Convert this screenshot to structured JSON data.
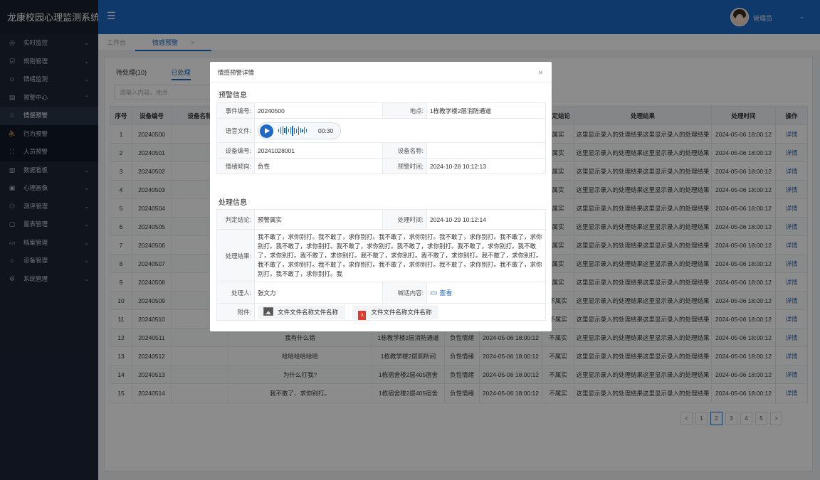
{
  "app": {
    "title": "龙康校园心理监测系统"
  },
  "sidebar": {
    "items": [
      {
        "label": "实时监控",
        "icon": "monitor-icon",
        "glyph": "◎",
        "arrow": "⌄"
      },
      {
        "label": "规则管理",
        "icon": "rules-icon",
        "glyph": "☑",
        "arrow": "⌄"
      },
      {
        "label": "情绪监测",
        "icon": "emotion-icon",
        "glyph": "☺",
        "arrow": "⌄"
      },
      {
        "label": "预警中心",
        "icon": "alert-center-icon",
        "glyph": "▤",
        "arrow": "⌃"
      },
      {
        "label": "情感预警",
        "icon": "bell-icon",
        "glyph": "♧",
        "arrow": ""
      },
      {
        "label": "行为预警",
        "icon": "run-icon",
        "glyph": "⛹",
        "arrow": ""
      },
      {
        "label": "人员预警",
        "icon": "person-scan-icon",
        "glyph": "⛶",
        "arrow": ""
      },
      {
        "label": "数据看板",
        "icon": "dashboard-icon",
        "glyph": "▥",
        "arrow": "⌄"
      },
      {
        "label": "心理画像",
        "icon": "portrait-icon",
        "glyph": "▣",
        "arrow": "⌄"
      },
      {
        "label": "测评管理",
        "icon": "assessment-icon",
        "glyph": "⚇",
        "arrow": "⌄"
      },
      {
        "label": "量表管理",
        "icon": "scale-icon",
        "glyph": "▢",
        "arrow": "⌄"
      },
      {
        "label": "档案管理",
        "icon": "archive-icon",
        "glyph": "▭",
        "arrow": "⌄"
      },
      {
        "label": "设备管理",
        "icon": "device-icon",
        "glyph": "⌂",
        "arrow": "⌄"
      },
      {
        "label": "系统管理",
        "icon": "settings-icon",
        "glyph": "⚙",
        "arrow": "⌄"
      }
    ]
  },
  "header": {
    "menu_glyph": "☰",
    "user_name": "管理员",
    "user_arrow": "⌄"
  },
  "tabs": {
    "workbench": "工作台",
    "current": "情感预警",
    "close": "×"
  },
  "subtabs": {
    "pending": "待处理(10)",
    "done": "已处理"
  },
  "search": {
    "placeholder": "请输入内容、地点"
  },
  "table": {
    "headers": [
      "序号",
      "设备编号",
      "设备名称",
      "",
      "",
      "",
      "",
      "判定结论",
      "处理结果",
      "处理时间",
      "操作"
    ],
    "rows": [
      [
        "1",
        "20240500",
        "",
        "",
        "",
        "",
        "",
        "属实",
        "这里显示录入的处理结果这里显示录入的处理结果",
        "2024-05-06 18:00:12",
        "详情"
      ],
      [
        "2",
        "20240501",
        "",
        "",
        "",
        "",
        "",
        "属实",
        "这里显示录入的处理结果这里显示录入的处理结果",
        "2024-05-06 18:00:12",
        "详情"
      ],
      [
        "3",
        "20240502",
        "",
        "",
        "",
        "",
        "",
        "属实",
        "这里显示录入的处理结果这里显示录入的处理结果",
        "2024-05-06 18:00:12",
        "详情"
      ],
      [
        "4",
        "20240503",
        "",
        "",
        "",
        "",
        "",
        "属实",
        "这里显示录入的处理结果这里显示录入的处理结果",
        "2024-05-06 18:00:12",
        "详情"
      ],
      [
        "5",
        "20240504",
        "",
        "",
        "",
        "",
        "",
        "属实",
        "这里显示录入的处理结果这里显示录入的处理结果",
        "2024-05-06 18:00:12",
        "详情"
      ],
      [
        "6",
        "20240505",
        "",
        "",
        "",
        "",
        "",
        "属实",
        "这里显示录入的处理结果这里显示录入的处理结果",
        "2024-05-06 18:00:12",
        "详情"
      ],
      [
        "7",
        "20240506",
        "",
        "",
        "",
        "",
        "",
        "属实",
        "这里显示录入的处理结果这里显示录入的处理结果",
        "2024-05-06 18:00:12",
        "详情"
      ],
      [
        "8",
        "20240507",
        "",
        "",
        "",
        "",
        "",
        "属实",
        "这里显示录入的处理结果这里显示录入的处理结果",
        "2024-05-06 18:00:12",
        "详情"
      ],
      [
        "9",
        "20240508",
        "",
        "",
        "",
        "",
        "",
        "属实",
        "这里显示录入的处理结果这里显示录入的处理结果",
        "2024-05-06 18:00:12",
        "详情"
      ],
      [
        "10",
        "20240509",
        "",
        "",
        "",
        "",
        "",
        "不属实",
        "这里显示录入的处理结果这里显示录入的处理结果",
        "2024-05-06 18:00:12",
        "详情"
      ],
      [
        "11",
        "20240510",
        "",
        "",
        "",
        "",
        "",
        "不属实",
        "这里显示录入的处理结果这里显示录入的处理结果",
        "2024-05-06 18:00:12",
        "详情"
      ],
      [
        "12",
        "20240511",
        "",
        "我有什么错",
        "1栋教学楼2层消防通道",
        "负性情绪",
        "2024-05-06 18:00:12",
        "不属实",
        "这里显示录入的处理结果这里显示录入的处理结果",
        "2024-05-06 18:00:12",
        "详情"
      ],
      [
        "13",
        "20240512",
        "",
        "哈哈哈哈哈哈",
        "1栋教学楼2层厕所间",
        "负性情绪",
        "2024-05-06 18:00:12",
        "不属实",
        "这里显示录入的处理结果这里显示录入的处理结果",
        "2024-05-06 18:00:12",
        "详情"
      ],
      [
        "14",
        "20240513",
        "",
        "为什么打我?",
        "1栋宿舍楼2层405宿舍",
        "负性情绪",
        "2024-05-06 18:00:12",
        "不属实",
        "这里显示录入的处理结果这里显示录入的处理结果",
        "2024-05-06 18:00:12",
        "详情"
      ],
      [
        "15",
        "20240514",
        "",
        "我不敢了、求你别打。",
        "1栋宿舍楼2层405宿舍",
        "负性情绪",
        "2024-05-06 18:00:12",
        "不属实",
        "这里显示录入的处理结果这里显示录入的处理结果",
        "2024-05-06 18:00:12",
        "详情"
      ]
    ]
  },
  "pagination": {
    "prev": "<",
    "pages": [
      "1",
      "2",
      "3",
      "4",
      "5"
    ],
    "current": "2",
    "next": ">"
  },
  "modal": {
    "title": "情感预警详情",
    "close": "×",
    "section_alert": "预警信息",
    "event_no_label": "事件编号:",
    "event_no": "20240500",
    "location_label": "地点:",
    "location": "1栋教学楼2层消防通道",
    "audio_label": "语音文件:",
    "audio_duration": "00:30",
    "device_no_label": "设备编号:",
    "device_no": "20241028001",
    "device_name_label": "设备名称:",
    "device_name": "",
    "emotion_label": "情绪倾向:",
    "emotion": "负性",
    "alert_time_label": "预警时间:",
    "alert_time": "2024-10-28 10:12:13",
    "section_handle": "处理信息",
    "verdict_label": "判定结论:",
    "verdict": "预警属实",
    "handle_time_label": "处理时间:",
    "handle_time": "2024-10-29 10:12:14",
    "result_label": "处理结果:",
    "result": "我不敢了，求你别打。我不敢了，求你别打。我不敢了，求你别打。我不敢了，求你别打。我不敢了，求你别打。我不敢了，求你别打。我不敢了，求你别打。我不敢了，求你别打。我不敢了，求你别打。我不敢了，求你别打。我不敢了，求你别打。我不敢了，求你别打。我不敢了，求你别打。我不敢了，求你别打。我不敢了，求你别打。我不敢了，求你别打。我不敢了，求你别打。我不敢了，求你别打。我不敢了，求你别打。我不敢了，求你别打。我",
    "handler_label": "处理人:",
    "handler": "张文力",
    "shout_label": "喊话内容:",
    "shout_view": "查看",
    "attach_label": "附件:",
    "files": [
      "文件文件名称文件名称",
      "文件文件名称文件名称"
    ]
  },
  "colors": {
    "primary": "#1d69c4",
    "sidebar": "#1c2536",
    "danger": "#e03b2f"
  }
}
